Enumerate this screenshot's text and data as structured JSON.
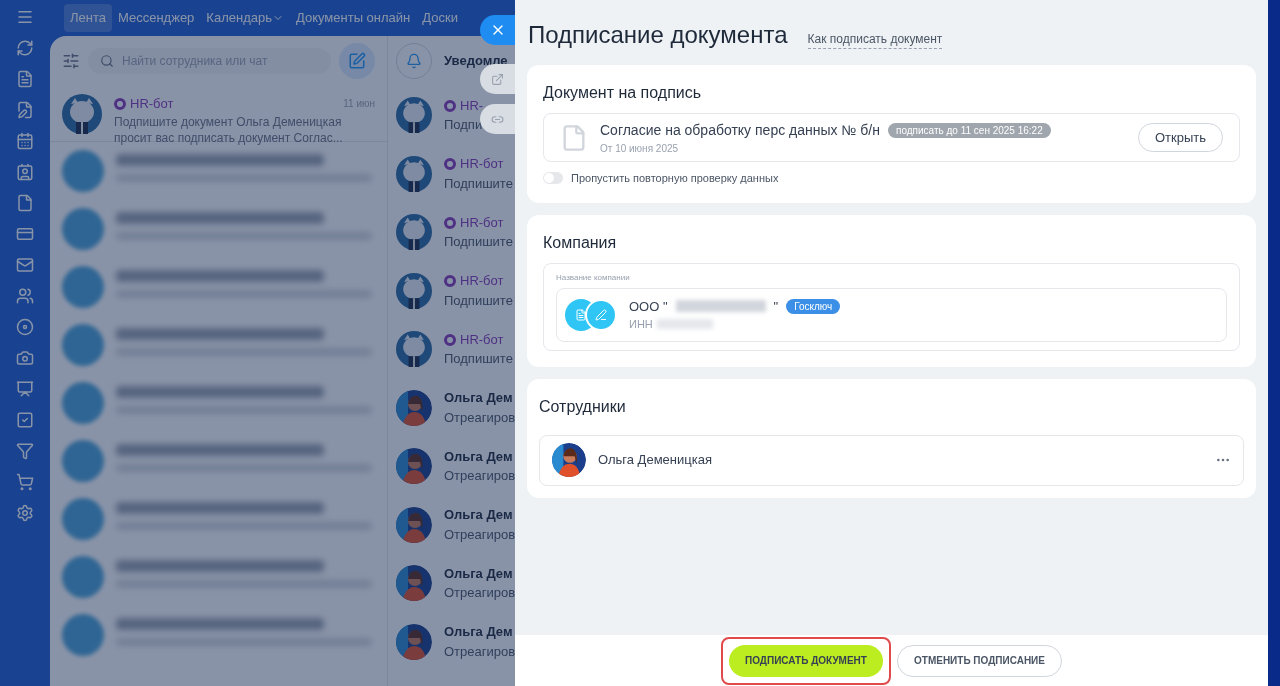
{
  "nav_tabs": [
    {
      "label": "Лента",
      "selected": true,
      "dropdown": false
    },
    {
      "label": "Мессенджер",
      "selected": false,
      "dropdown": false
    },
    {
      "label": "Календарь",
      "selected": false,
      "dropdown": true
    },
    {
      "label": "Документы онлайн",
      "selected": false,
      "dropdown": false
    },
    {
      "label": "Доски",
      "selected": false,
      "dropdown": false
    }
  ],
  "chat_search": {
    "placeholder": "Найти сотрудника или чат"
  },
  "chats": [
    {
      "kind": "bot",
      "name": "HR-бот",
      "time": "11 июн",
      "text": "Подпишите документ Ольга Деменицкая просит вас подписать документ Соглас..."
    },
    {
      "kind": "blurred"
    },
    {
      "kind": "blurred"
    },
    {
      "kind": "blurred"
    },
    {
      "kind": "blurred"
    },
    {
      "kind": "blurred"
    },
    {
      "kind": "blurred"
    },
    {
      "kind": "blurred"
    },
    {
      "kind": "blurred"
    },
    {
      "kind": "blurred"
    }
  ],
  "notifications": {
    "title": "Уведомле",
    "items": [
      {
        "kind": "bot",
        "name": "HR-",
        "text": "Подпи"
      },
      {
        "kind": "bot",
        "name": "HR-бот",
        "text": "Подпишите"
      },
      {
        "kind": "bot",
        "name": "HR-бот",
        "text": "Подпишите"
      },
      {
        "kind": "bot",
        "name": "HR-бот",
        "text": "Подпишите"
      },
      {
        "kind": "bot",
        "name": "HR-бот",
        "text": "Подпишите"
      },
      {
        "kind": "person",
        "name": "Ольга Дем",
        "text": "Отреагиров"
      },
      {
        "kind": "person",
        "name": "Ольга Дем",
        "text": "Отреагиров"
      },
      {
        "kind": "person",
        "name": "Ольга Дем",
        "text": "Отреагиров"
      },
      {
        "kind": "person",
        "name": "Ольга Дем",
        "text": "Отреагиров"
      },
      {
        "kind": "person",
        "name": "Ольга Дем",
        "text": "Отреагиров"
      }
    ]
  },
  "modal": {
    "title": "Подписание документа",
    "help_link": "Как подписать документ",
    "document_section": {
      "heading": "Документ на подпись",
      "name": "Согласие на обработку перс данных № б/н",
      "deadline": "подписать до 11 сен 2025 16:22",
      "date": "От 10 июня 2025",
      "open_button": "Открыть",
      "toggle": {
        "label": "Пропустить повторную проверку данных",
        "on": false
      }
    },
    "company_section": {
      "heading": "Компания",
      "field_label": "Название компании",
      "company_prefix": "ООО \"",
      "company_suffix": "\"",
      "badge": "Госключ",
      "inn_label": "ИНН"
    },
    "employees_section": {
      "heading": "Сотрудники",
      "employees": [
        {
          "name": "Ольга Деменицкая"
        }
      ]
    },
    "footer": {
      "sign_button": "ПОДПИСАТЬ ДОКУМЕНТ",
      "cancel_button": "ОТМЕНИТЬ ПОДПИСАНИЕ"
    }
  }
}
